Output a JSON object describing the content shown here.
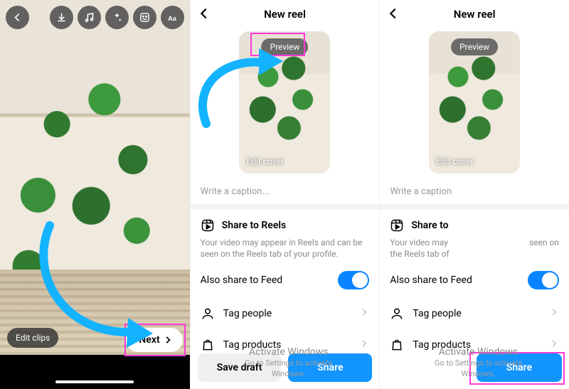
{
  "screen1": {
    "toolbar_icons": [
      "back-icon",
      "download-icon",
      "music-icon",
      "effects-icon",
      "sticker-icon",
      "text-icon"
    ],
    "edit_clips_label": "Edit clips",
    "next_label": "Next"
  },
  "screen2": {
    "header_title": "New reel",
    "preview_label": "Preview",
    "edit_cover_label": "Edit cover",
    "caption_placeholder": "Write a caption...",
    "share_section_title": "Share to Reels",
    "share_section_desc": "Your video may appear in Reels and can be seen on the Reels tab of your profile.",
    "also_share_label": "Also share to Feed",
    "also_share_on": true,
    "tag_people_label": "Tag people",
    "tag_products_label": "Tag products",
    "save_draft_label": "Save draft",
    "share_button_label": "Share"
  },
  "screen3": {
    "header_title": "New reel",
    "preview_label": "Preview",
    "edit_cover_label": "Edit cover",
    "caption_placeholder": "Write a caption",
    "share_section_title": "Share to",
    "share_section_desc_left": "Your video may",
    "share_section_desc_right": "seen on",
    "share_section_desc_line2": "the Reels tab of",
    "also_share_label": "Also share to Feed",
    "also_share_on": true,
    "tag_people_label": "Tag people",
    "tag_products_label": "Tag products",
    "share_button_label": "Share"
  },
  "watermark": {
    "title": "Activate Windows",
    "sub": "Go to Settings to activate Windows."
  },
  "colors": {
    "accent_blue": "#1295ff",
    "highlight_pink": "#ff3bd6",
    "arrow_blue": "#13b3ff"
  }
}
